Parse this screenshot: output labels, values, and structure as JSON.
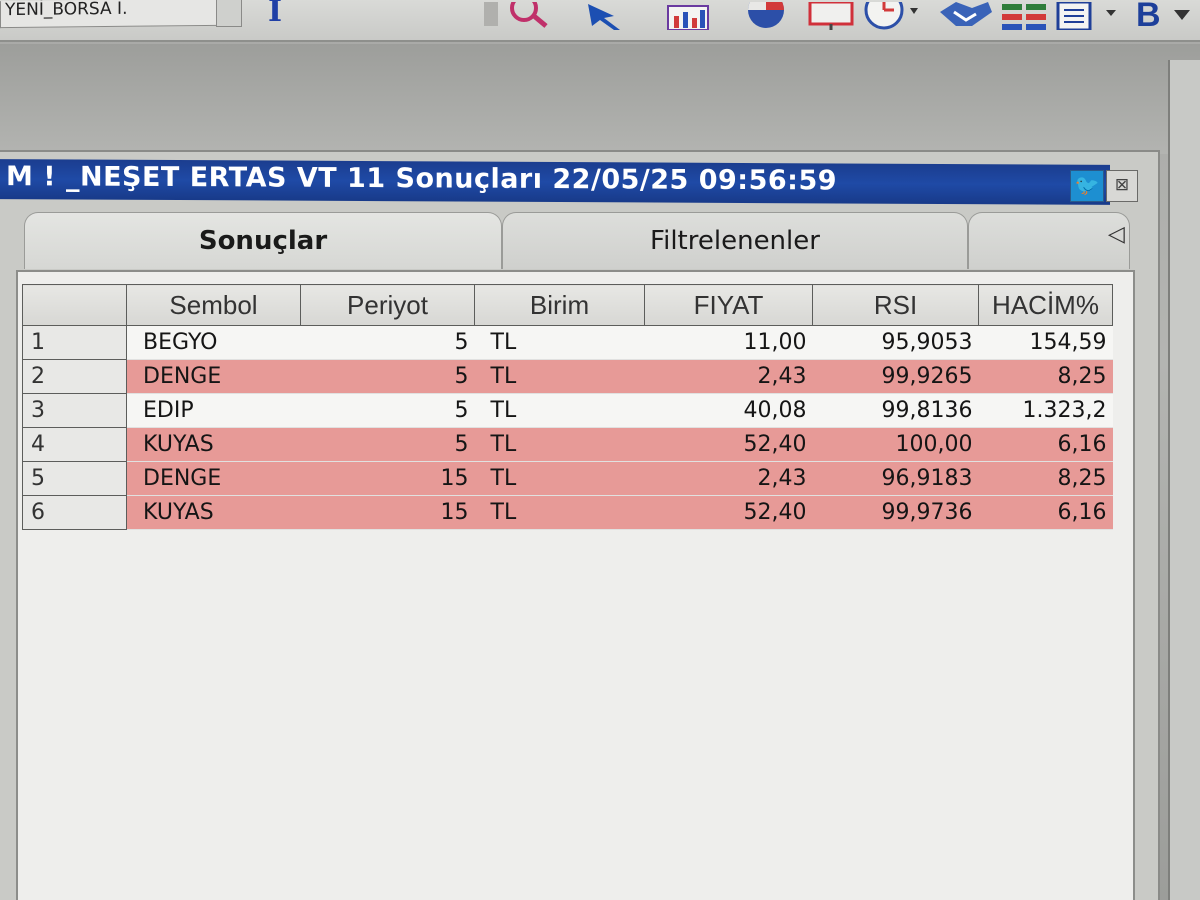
{
  "toolbar": {
    "combo_value": "YENİ_BORSA I.",
    "text_tool": "I",
    "bold_tool": "B"
  },
  "window": {
    "title": "M ! _NEŞET ERTAS  VT 11 Sonuçları  22/05/25 09:56:59",
    "close_glyph": "⊠",
    "twitter_glyph": "🐦"
  },
  "tabs": [
    {
      "label": "Sonuçlar",
      "active": true
    },
    {
      "label": "Filtrelenenler",
      "active": false
    }
  ],
  "tab_scroll_glyph": "◁",
  "grid": {
    "columns": [
      "Sembol",
      "Periyot",
      "Birim",
      "FIYAT",
      "RSI",
      "HACİM%"
    ],
    "rows": [
      {
        "n": "1",
        "symbol": "BEGYO",
        "period": "5",
        "unit": "TL",
        "price": "11,00",
        "rsi": "95,9053",
        "volume": "154,59",
        "highlight": false
      },
      {
        "n": "2",
        "symbol": "DENGE",
        "period": "5",
        "unit": "TL",
        "price": "2,43",
        "rsi": "99,9265",
        "volume": "8,25",
        "highlight": true
      },
      {
        "n": "3",
        "symbol": "EDIP",
        "period": "5",
        "unit": "TL",
        "price": "40,08",
        "rsi": "99,8136",
        "volume": "1.323,2",
        "highlight": false
      },
      {
        "n": "4",
        "symbol": "KUYAS",
        "period": "5",
        "unit": "TL",
        "price": "52,40",
        "rsi": "100,00",
        "volume": "6,16",
        "highlight": true
      },
      {
        "n": "5",
        "symbol": "DENGE",
        "period": "15",
        "unit": "TL",
        "price": "2,43",
        "rsi": "96,9183",
        "volume": "8,25",
        "highlight": true
      },
      {
        "n": "6",
        "symbol": "KUYAS",
        "period": "15",
        "unit": "TL",
        "price": "52,40",
        "rsi": "99,9736",
        "volume": "6,16",
        "highlight": true
      }
    ]
  },
  "colors": {
    "title_bar": "#1f4aa6",
    "row_highlight": "#e79a97",
    "row_normal": "#f6f6f4"
  }
}
